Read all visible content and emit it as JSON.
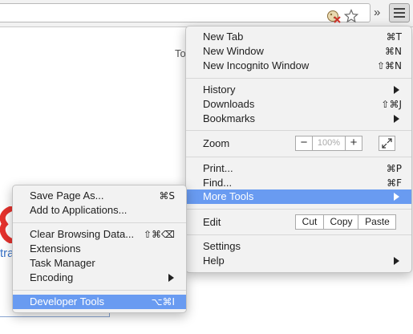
{
  "page": {
    "partial_text": "To",
    "partial_link": "tra"
  },
  "toolbar": {
    "overflow_glyph": "»",
    "icons": [
      "extension-icon",
      "bookmark-star-icon",
      "hamburger-menu-icon"
    ]
  },
  "main_menu": {
    "new_tab": {
      "label": "New Tab",
      "shortcut": "⌘T"
    },
    "new_window": {
      "label": "New Window",
      "shortcut": "⌘N"
    },
    "new_incognito": {
      "label": "New Incognito Window",
      "shortcut": "⇧⌘N"
    },
    "history": {
      "label": "History"
    },
    "downloads": {
      "label": "Downloads",
      "shortcut": "⇧⌘J"
    },
    "bookmarks": {
      "label": "Bookmarks"
    },
    "zoom": {
      "label": "Zoom",
      "minus": "−",
      "level": "100%",
      "plus": "+"
    },
    "print": {
      "label": "Print...",
      "shortcut": "⌘P"
    },
    "find": {
      "label": "Find...",
      "shortcut": "⌘F"
    },
    "more_tools": {
      "label": "More Tools"
    },
    "edit": {
      "label": "Edit",
      "cut": "Cut",
      "copy": "Copy",
      "paste": "Paste"
    },
    "settings": {
      "label": "Settings"
    },
    "help": {
      "label": "Help"
    }
  },
  "sub_menu": {
    "save_page": {
      "label": "Save Page As...",
      "shortcut": "⌘S"
    },
    "add_apps": {
      "label": "Add to Applications..."
    },
    "clear_data": {
      "label": "Clear Browsing Data...",
      "shortcut": "⇧⌘⌫"
    },
    "extensions": {
      "label": "Extensions"
    },
    "task_manager": {
      "label": "Task Manager"
    },
    "encoding": {
      "label": "Encoding"
    },
    "dev_tools": {
      "label": "Developer Tools",
      "shortcut": "⌥⌘I"
    }
  },
  "colors": {
    "highlight": "#699bf1",
    "menu_bg": "#f2f2f2"
  }
}
